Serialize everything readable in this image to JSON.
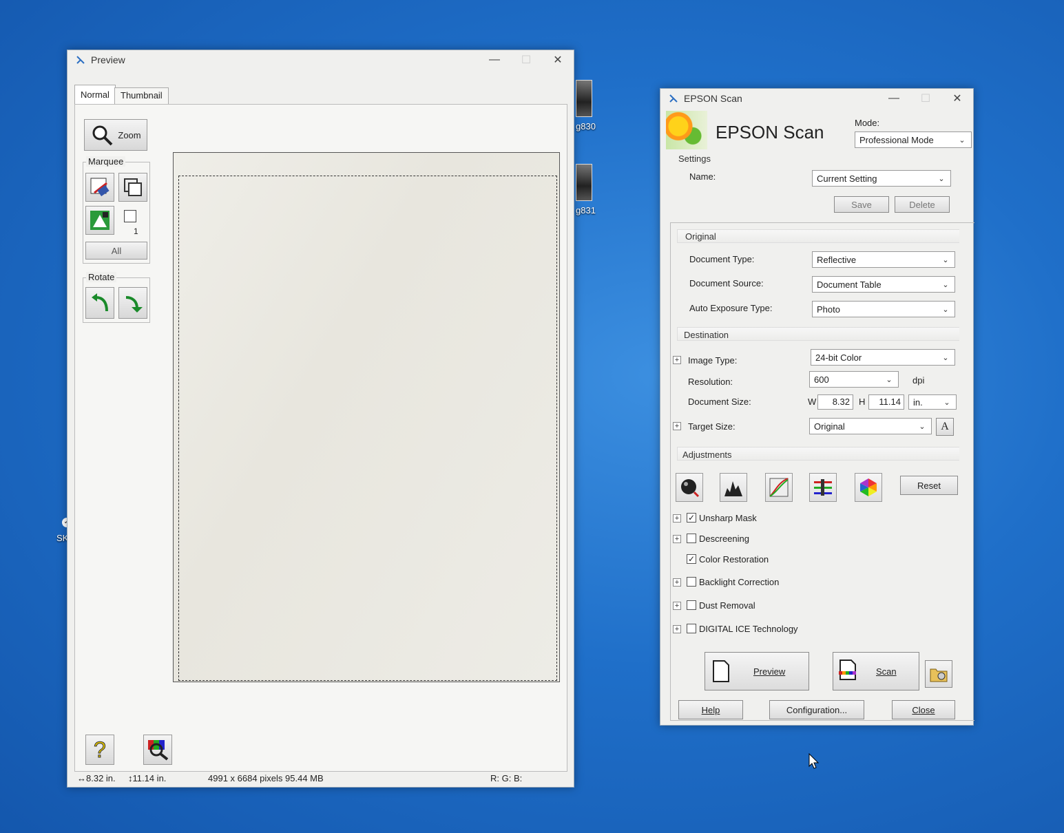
{
  "desktop": {
    "icons": [
      {
        "label": "g830"
      },
      {
        "label": "g831"
      },
      {
        "label": "SKE"
      }
    ]
  },
  "preview_window": {
    "title": "Preview",
    "tabs": [
      {
        "label": "Normal"
      },
      {
        "label": "Thumbnail"
      }
    ],
    "zoom_label": "Zoom",
    "marquee_label": "Marquee",
    "marquee_count": "1",
    "all_label": "All",
    "rotate_label": "Rotate",
    "status": {
      "width": "8.32 in.",
      "height": "11.14 in.",
      "pixels": "4991 x 6684 pixels 95.44 MB",
      "rgb": "R: G: B:"
    }
  },
  "epson_window": {
    "title": "EPSON Scan",
    "banner": "EPSON Scan",
    "mode_label": "Mode:",
    "mode_value": "Professional Mode",
    "settings": {
      "title": "Settings",
      "name_label": "Name:",
      "name_value": "Current Setting",
      "save": "Save",
      "delete": "Delete"
    },
    "original": {
      "title": "Original",
      "doc_type_label": "Document Type:",
      "doc_type_value": "Reflective",
      "doc_source_label": "Document Source:",
      "doc_source_value": "Document Table",
      "auto_exp_label": "Auto Exposure Type:",
      "auto_exp_value": "Photo"
    },
    "destination": {
      "title": "Destination",
      "image_type_label": "Image Type:",
      "image_type_value": "24-bit Color",
      "resolution_label": "Resolution:",
      "resolution_value": "600",
      "dpi": "dpi",
      "doc_size_label": "Document Size:",
      "w_label": "W",
      "w_value": "8.32",
      "h_label": "H",
      "h_value": "11.14",
      "unit_value": "in.",
      "target_size_label": "Target Size:",
      "target_size_value": "Original"
    },
    "adjustments": {
      "title": "Adjustments",
      "reset": "Reset",
      "options": [
        {
          "label": "Unsharp Mask",
          "checked": "✓"
        },
        {
          "label": "Descreening",
          "checked": ""
        },
        {
          "label": "Color Restoration",
          "checked": "✓"
        },
        {
          "label": "Backlight Correction",
          "checked": ""
        },
        {
          "label": "Dust Removal",
          "checked": ""
        },
        {
          "label": "DIGITAL ICE Technology",
          "checked": ""
        }
      ]
    },
    "preview_btn": "Preview",
    "scan_btn": "Scan",
    "help_btn": "Help",
    "config_btn": "Configuration...",
    "close_btn": "Close"
  }
}
